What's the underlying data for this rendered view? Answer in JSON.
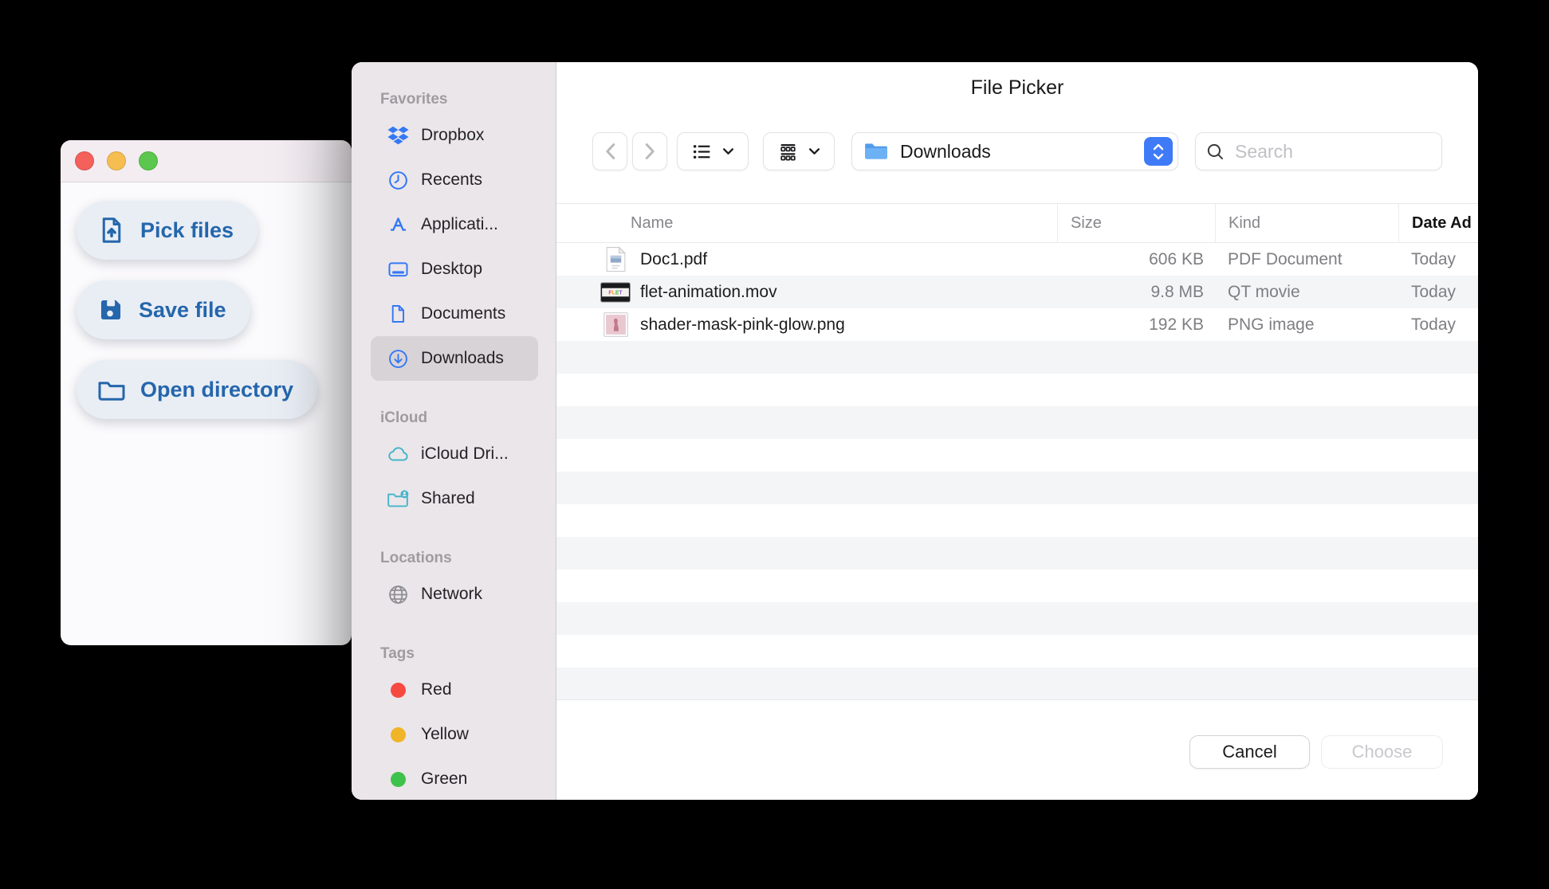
{
  "window": {
    "buttons": [
      {
        "label": "Pick files"
      },
      {
        "label": "Save file"
      },
      {
        "label": "Open directory"
      }
    ]
  },
  "dialog": {
    "title": "File Picker",
    "sidebar": {
      "sections": [
        {
          "header": "Favorites",
          "items": [
            {
              "label": "Dropbox"
            },
            {
              "label": "Recents"
            },
            {
              "label": "Applicati..."
            },
            {
              "label": "Desktop"
            },
            {
              "label": "Documents"
            },
            {
              "label": "Downloads",
              "selected": true
            }
          ]
        },
        {
          "header": "iCloud",
          "items": [
            {
              "label": "iCloud Dri..."
            },
            {
              "label": "Shared"
            }
          ]
        },
        {
          "header": "Locations",
          "items": [
            {
              "label": "Network"
            }
          ]
        },
        {
          "header": "Tags",
          "items": [
            {
              "label": "Red",
              "color": "#f64a41"
            },
            {
              "label": "Yellow",
              "color": "#f0b428"
            },
            {
              "label": "Green",
              "color": "#3fc24c"
            }
          ]
        }
      ]
    },
    "toolbar": {
      "path_selector": {
        "value": "Downloads"
      },
      "search": {
        "placeholder": "Search"
      }
    },
    "table": {
      "columns": {
        "name": "Name",
        "size": "Size",
        "kind": "Kind",
        "date_added": "Date Ad"
      },
      "sorted_column": "Date Ad",
      "rows": [
        {
          "name": "Doc1.pdf",
          "size": "606 KB",
          "kind": "PDF Document",
          "date_added": "Today"
        },
        {
          "name": "flet-animation.mov",
          "size": "9.8 MB",
          "kind": "QT movie",
          "date_added": "Today"
        },
        {
          "name": "shader-mask-pink-glow.png",
          "size": "192 KB",
          "kind": "PNG image",
          "date_added": "Today"
        }
      ]
    },
    "footer": {
      "cancel": "Cancel",
      "choose": "Choose"
    },
    "colors": {
      "accent_blue": "#3478f6",
      "teal": "#45b5cb",
      "stepper_blue": "#3f7bf6",
      "selection_gray": "#d8d3d7"
    }
  }
}
